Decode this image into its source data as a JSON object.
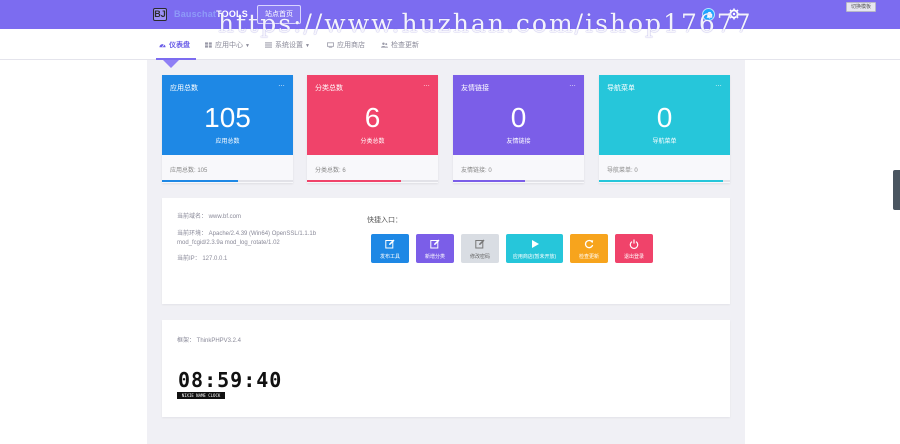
{
  "header": {
    "logo_mark": "BJ",
    "logo_faint": "Bauschat",
    "logo_strong": "TOOLS",
    "home_button": "站点首页",
    "corner_button": "切换模板",
    "watermark": "https://www.huzhan.com/ishop17677",
    "colors": {
      "bar": "#7c6cf0",
      "bell": "#1ea6ff"
    }
  },
  "nav": {
    "items": [
      {
        "label": "仪表盘",
        "icon": "dashboard-icon",
        "active": true
      },
      {
        "label": "应用中心",
        "icon": "grid-icon",
        "caret": true
      },
      {
        "label": "系统设置",
        "icon": "list-icon",
        "caret": true
      },
      {
        "label": "应用商店",
        "icon": "monitor-icon"
      },
      {
        "label": "检查更新",
        "icon": "users-icon"
      }
    ],
    "caret": "▼"
  },
  "cards": [
    {
      "label": "应用总数",
      "value": "105",
      "sub": "应用总数",
      "foot": "应用总数: 105",
      "color": "#1e88e5",
      "progress": 0.58
    },
    {
      "label": "分类总数",
      "value": "6",
      "sub": "分类总数",
      "foot": "分类总数: 6",
      "color": "#f0436a",
      "progress": 0.72
    },
    {
      "label": "友情链接",
      "value": "0",
      "sub": "友情链接",
      "foot": "友情链接: 0",
      "color": "#7b5ee8",
      "progress": 0.55
    },
    {
      "label": "导航菜单",
      "value": "0",
      "sub": "导航菜单",
      "foot": "导航菜单: 0",
      "color": "#26c6da",
      "progress": 0.95
    }
  ],
  "card_menu": "…",
  "info": {
    "domain": "当前域名：  www.bf.com",
    "env_line1": "当前环境：  Apache/2.4.39 (Win64) OpenSSL/1.1.1b",
    "env_line2": "mod_fcgid/2.3.9a mod_log_rotate/1.02",
    "ip": "当前IP：  127.0.0.1"
  },
  "quick_entry": {
    "title": "快捷入口：",
    "buttons": [
      {
        "label": "发布工具",
        "icon": "edit-icon",
        "color": "#1e88e5"
      },
      {
        "label": "新增分类",
        "icon": "edit-icon",
        "color": "#7b5ee8"
      },
      {
        "label": "修改密码",
        "icon": "edit-icon",
        "color": "#d9dde3",
        "text_color": "#666"
      },
      {
        "label": "应用商店(暂未开放)",
        "icon": "play-icon",
        "color": "#26c6da"
      },
      {
        "label": "检查更新",
        "icon": "refresh-icon",
        "color": "#f7a41d"
      },
      {
        "label": "退出登录",
        "icon": "power-icon",
        "color": "#f0436a"
      }
    ]
  },
  "framework": {
    "label": "框架：  ThinkPHPV3.2.4",
    "clock": "08:59:40",
    "clock_caption": "NIXIE NAME CLOCK"
  }
}
